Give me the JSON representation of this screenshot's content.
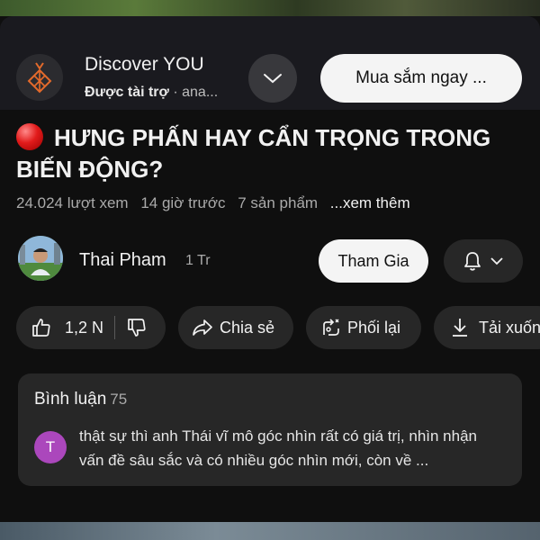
{
  "ad": {
    "title": "Discover YOU",
    "sponsored": "Được tài trợ",
    "dot": " · ",
    "advertiser": "ana...",
    "cta": "Mua sắm ngay ..."
  },
  "video": {
    "title": "HƯNG PHẤN HAY CẨN TRỌNG TRONG BIẾN ĐỘNG?",
    "views": "24.024 lượt xem",
    "time": "14 giờ trước",
    "products": "7 sản phẩm",
    "more": "...xem thêm"
  },
  "channel": {
    "name": "Thai Pham",
    "subscribers": "1 Tr",
    "join": "Tham Gia"
  },
  "actions": {
    "likes": "1,2 N",
    "share": "Chia sẻ",
    "remix": "Phối lại",
    "download": "Tải xuống"
  },
  "comments": {
    "label": "Bình luận",
    "count": "75",
    "avatar_initial": "T",
    "avatar_color": "#ab47bc",
    "top_comment": "thật sự thì anh Thái vĩ mô góc nhìn rất có giá trị, nhìn nhận vấn đề sâu sắc và có nhiều góc nhìn mới, còn về ..."
  },
  "icons": {
    "ad_logo": "pineapple-logo-icon",
    "expand": "chevron-down-icon",
    "bell": "bell-icon",
    "like": "thumbs-up-icon",
    "dislike": "thumbs-down-icon",
    "share": "share-arrow-icon",
    "remix": "remix-icon",
    "download": "download-icon"
  }
}
